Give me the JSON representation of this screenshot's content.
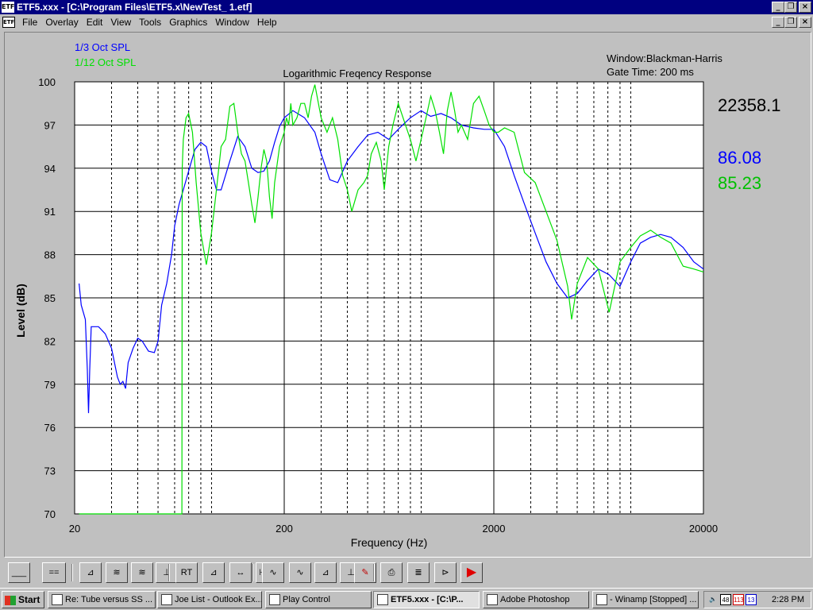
{
  "window": {
    "title": "ETF5.xxx - [C:\\Program Files\\ETF5.x\\NewTest_ 1.etf]",
    "app_icon": "ETF"
  },
  "menu": [
    "File",
    "Overlay",
    "Edit",
    "View",
    "Tools",
    "Graphics",
    "Window",
    "Help"
  ],
  "info": {
    "legend_13oct": "1/3 Oct SPL",
    "legend_112oct": "1/12 Oct SPL",
    "window_fn": "Window:Blackman-Harris",
    "gate_time": "Gate Time: 200 ms",
    "readout_freq": "22358.1",
    "readout_blue": "86.08",
    "readout_green": "85.23"
  },
  "chart_data": {
    "type": "line",
    "title": "Logarithmic Freqency Response",
    "xlabel": "Frequency (Hz)",
    "ylabel": "Level (dB)",
    "xscale": "log",
    "xlim": [
      20,
      20000
    ],
    "ylim": [
      70,
      100
    ],
    "x_tick_labels": [
      "20",
      "200",
      "2000",
      "20000"
    ],
    "y_tick_labels": [
      "100",
      "97",
      "94",
      "91",
      "88",
      "85",
      "82",
      "79",
      "76",
      "73",
      "70"
    ],
    "grid": true,
    "series": [
      {
        "name": "1/3 Oct SPL",
        "color": "#0000ff",
        "x": [
          21,
          21.5,
          22,
          22.5,
          23,
          23.3,
          23.6,
          24,
          26,
          28,
          30,
          31,
          32,
          33,
          34,
          35,
          36,
          38,
          40,
          42,
          45,
          48,
          50,
          52,
          55,
          58,
          60,
          63,
          66,
          70,
          75,
          80,
          85,
          90,
          95,
          100,
          110,
          120,
          130,
          140,
          150,
          160,
          170,
          180,
          190,
          200,
          220,
          250,
          280,
          300,
          330,
          360,
          400,
          450,
          500,
          560,
          630,
          710,
          800,
          900,
          1000,
          1120,
          1250,
          1400,
          1600,
          1800,
          2000,
          2250,
          2500,
          2800,
          3150,
          3550,
          4000,
          4500,
          5000,
          5600,
          6300,
          7100,
          8000,
          9000,
          10000,
          11200,
          12500,
          14000,
          16000,
          18000,
          20000
        ],
        "y": [
          86,
          84.5,
          84,
          83.5,
          80,
          77,
          80,
          83,
          83,
          82.5,
          81.5,
          80.5,
          79.5,
          79,
          79.2,
          78.7,
          80.5,
          81.5,
          82.2,
          82,
          81.3,
          81.2,
          82,
          84.5,
          86,
          88,
          90,
          91.5,
          92.5,
          93.8,
          95.3,
          95.8,
          95.5,
          93.8,
          92.5,
          92.5,
          94.5,
          96.2,
          95.5,
          94,
          93.7,
          93.8,
          94.5,
          95.8,
          96.9,
          97.5,
          98,
          97.5,
          96.5,
          95,
          93.2,
          93,
          94.5,
          95.5,
          96.3,
          96.5,
          96,
          96.8,
          97.5,
          98,
          97.6,
          97.8,
          97.5,
          97,
          96.8,
          96.7,
          96.7,
          95.5,
          93.5,
          91.5,
          89.5,
          87.5,
          86,
          85,
          85.3,
          86.2,
          87,
          86.6,
          85.8,
          87.5,
          88.8,
          89.2,
          89.4,
          89.2,
          88.5,
          87.5,
          87
        ]
      },
      {
        "name": "1/12 Oct SPL",
        "color": "#00e000",
        "x": [
          21,
          30,
          40,
          50,
          60,
          65,
          65.2,
          66,
          68,
          70,
          73,
          76,
          80,
          85,
          90,
          95,
          100,
          105,
          110,
          115,
          120,
          125,
          130,
          135,
          140,
          145,
          150,
          155,
          160,
          165,
          170,
          175,
          180,
          190,
          200,
          205,
          210,
          215,
          220,
          230,
          240,
          250,
          260,
          270,
          280,
          300,
          320,
          340,
          360,
          380,
          400,
          420,
          450,
          480,
          500,
          520,
          550,
          580,
          600,
          630,
          660,
          700,
          750,
          800,
          850,
          900,
          950,
          1000,
          1050,
          1100,
          1150,
          1200,
          1250,
          1300,
          1350,
          1400,
          1500,
          1600,
          1700,
          1800,
          1900,
          2000,
          2100,
          2250,
          2500,
          2800,
          3150,
          3550,
          4000,
          4500,
          4700,
          5000,
          5600,
          6300,
          7100,
          8000,
          9000,
          10000,
          11200,
          12500,
          14000,
          16000,
          18000,
          20000
        ],
        "y": [
          70,
          70,
          70,
          70,
          70,
          70,
          94,
          96,
          97.5,
          97.8,
          96.5,
          93,
          89.5,
          87.3,
          89.5,
          92.5,
          95.5,
          96,
          98.3,
          98.5,
          96.5,
          95,
          94.5,
          93,
          91.5,
          90.2,
          92,
          94,
          95.3,
          94.5,
          92,
          90.5,
          93,
          95.5,
          96.5,
          97.5,
          97,
          98.5,
          97,
          97.5,
          98.5,
          98.5,
          97.5,
          99,
          99.8,
          97.5,
          96.5,
          97.5,
          96,
          93.5,
          92.5,
          91,
          92.5,
          93,
          93.5,
          95,
          95.8,
          94.5,
          92.5,
          95.5,
          97,
          98.5,
          97.2,
          96,
          94.5,
          96,
          97.5,
          99,
          98,
          96.5,
          95,
          98,
          99.3,
          98,
          96.5,
          97,
          96,
          98.5,
          99,
          98,
          97,
          96.5,
          96.5,
          96.8,
          96.5,
          93.7,
          93,
          91,
          89,
          85.8,
          83.5,
          86,
          87.8,
          87,
          84,
          87.5,
          88.5,
          89.3,
          89.7,
          89.2,
          88.8,
          87.2,
          87,
          86.8
        ]
      }
    ]
  },
  "toolbar": [
    {
      "name": "clear-plot-button",
      "label": "___"
    },
    {
      "name": "slider-button",
      "label": "=="
    },
    {
      "name": "impulse-button",
      "label": "⊿"
    },
    {
      "name": "waterfall-button",
      "label": "≋"
    },
    {
      "name": "waterfall-multi-button",
      "label": "≋"
    },
    {
      "name": "marker-button",
      "label": "⊥"
    },
    {
      "name": "rt-button",
      "label": "RT"
    },
    {
      "name": "energy-time-button",
      "label": "⊿"
    },
    {
      "name": "zoom-out-button",
      "label": "↔"
    },
    {
      "name": "zoom-gate-button",
      "label": "⊢⊣"
    },
    {
      "name": "response-button",
      "label": "∿"
    },
    {
      "name": "phase-button",
      "label": "∿"
    },
    {
      "name": "decay-button",
      "label": "⊿"
    },
    {
      "name": "cursor-button",
      "label": "⊥"
    },
    {
      "name": "color-button",
      "label": "✎"
    },
    {
      "name": "print-button",
      "label": "⎙"
    },
    {
      "name": "notes-button",
      "label": "≣"
    },
    {
      "name": "generator-button",
      "label": "⊳"
    },
    {
      "name": "stop-button",
      "label": "▶"
    }
  ],
  "taskbar": {
    "start_label": "Start",
    "tasks": [
      "Re: Tube versus SS ...",
      "Joe List - Outlook Ex...",
      "Play Control",
      "ETF5.xxx - [C:\\P...",
      "Adobe Photoshop",
      "- Winamp [Stopped] ..."
    ],
    "clock": "2:28 PM"
  }
}
